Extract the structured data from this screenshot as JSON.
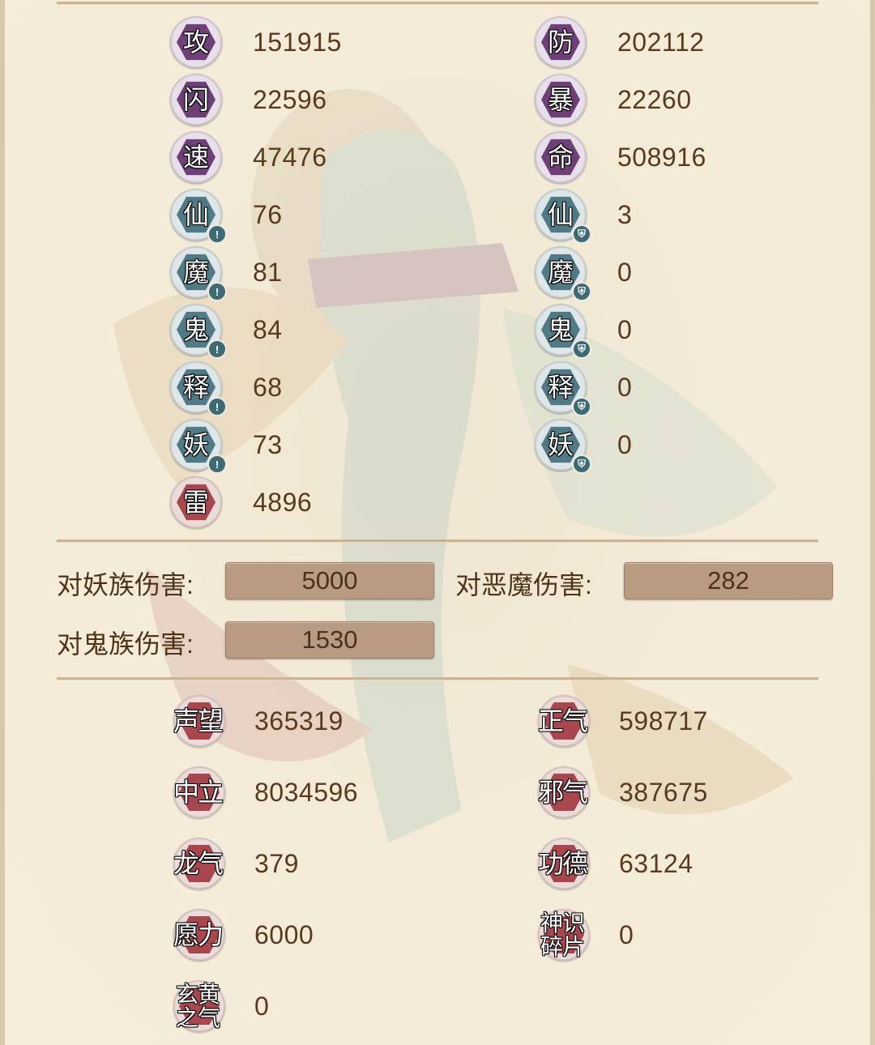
{
  "primary_stats": [
    {
      "icon": "攻",
      "value": "151915"
    },
    {
      "icon": "防",
      "value": "202112"
    },
    {
      "icon": "闪",
      "value": "22596"
    },
    {
      "icon": "暴",
      "value": "22260"
    },
    {
      "icon": "速",
      "value": "47476"
    },
    {
      "icon": "命",
      "value": "508916"
    }
  ],
  "attack_elements": [
    {
      "icon": "仙",
      "value": "76"
    },
    {
      "icon": "魔",
      "value": "81"
    },
    {
      "icon": "鬼",
      "value": "84"
    },
    {
      "icon": "释",
      "value": "68"
    },
    {
      "icon": "妖",
      "value": "73"
    }
  ],
  "resist_elements": [
    {
      "icon": "仙",
      "value": "3"
    },
    {
      "icon": "魔",
      "value": "0"
    },
    {
      "icon": "鬼",
      "value": "0"
    },
    {
      "icon": "释",
      "value": "0"
    },
    {
      "icon": "妖",
      "value": "0"
    }
  ],
  "thunder": {
    "icon": "雷",
    "value": "4896"
  },
  "damage": {
    "vs_yao": {
      "label": "对妖族伤害:",
      "value": "5000"
    },
    "vs_demon": {
      "label": "对恶魔伤害:",
      "value": "282"
    },
    "vs_ghost": {
      "label": "对鬼族伤害:",
      "value": "1530"
    }
  },
  "reputation": [
    {
      "line1": "声望",
      "line2": "",
      "value": "365319"
    },
    {
      "line1": "正气",
      "line2": "",
      "value": "598717"
    },
    {
      "line1": "中立",
      "line2": "",
      "value": "8034596"
    },
    {
      "line1": "邪气",
      "line2": "",
      "value": "387675"
    },
    {
      "line1": "龙气",
      "line2": "",
      "value": "379"
    },
    {
      "line1": "功德",
      "line2": "",
      "value": "63124"
    },
    {
      "line1": "愿力",
      "line2": "",
      "value": "6000"
    },
    {
      "line1": "神识",
      "line2": "碎片",
      "value": "0"
    },
    {
      "line1": "玄黄",
      "line2": "之气",
      "value": "0"
    }
  ],
  "badges": {
    "attack": "!",
    "resist": "⛨"
  },
  "colors": {
    "background": "#f5edd9",
    "purple": "#6f3f77",
    "teal": "#4f7a86",
    "red": "#a8474e",
    "value_box": "#b89b82"
  }
}
